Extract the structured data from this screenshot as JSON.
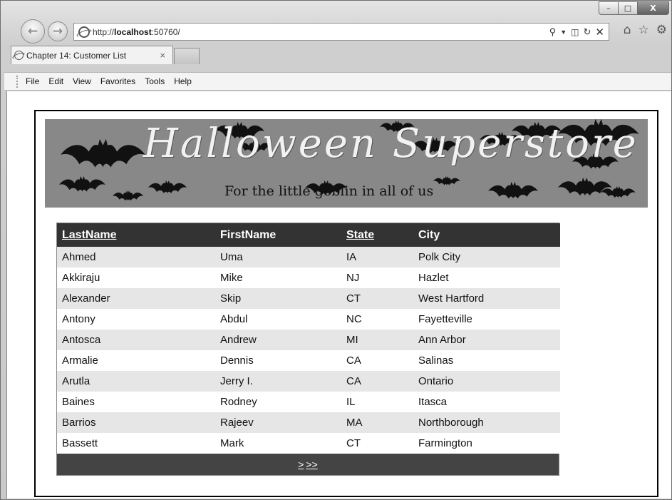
{
  "window": {
    "minimize": "–",
    "maximize": "□",
    "close": "X"
  },
  "address": {
    "prefix": "http://",
    "host": "localhost",
    "suffix": ":50760/"
  },
  "tab": {
    "title": "Chapter 14: Customer List",
    "close": "×"
  },
  "menu": [
    "File",
    "Edit",
    "View",
    "Favorites",
    "Tools",
    "Help"
  ],
  "banner": {
    "title": "Halloween Superstore",
    "subtitle": "For the little goblin in all of us"
  },
  "grid": {
    "headers": [
      "LastName",
      "FirstName",
      "State",
      "City"
    ],
    "rows": [
      [
        "Ahmed",
        "Uma",
        "IA",
        "Polk City"
      ],
      [
        "Akkiraju",
        "Mike",
        "NJ",
        "Hazlet"
      ],
      [
        "Alexander",
        "Skip",
        "CT",
        "West Hartford"
      ],
      [
        "Antony",
        "Abdul",
        "NC",
        "Fayetteville"
      ],
      [
        "Antosca",
        "Andrew",
        "MI",
        "Ann Arbor"
      ],
      [
        "Armalie",
        "Dennis",
        "CA",
        "Salinas"
      ],
      [
        "Arutla",
        "Jerry I.",
        "CA",
        "Ontario"
      ],
      [
        "Baines",
        "Rodney",
        "IL",
        "Itasca"
      ],
      [
        "Barrios",
        "Rajeev",
        "MA",
        "Northborough"
      ],
      [
        "Bassett",
        "Mark",
        "CT",
        "Farmington"
      ]
    ],
    "pager_next": ">",
    "pager_last": ">>"
  }
}
